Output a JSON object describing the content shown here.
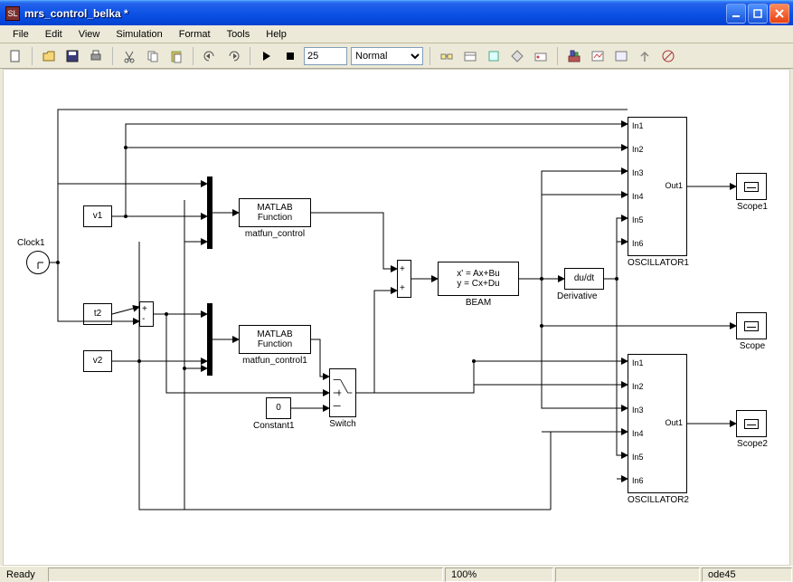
{
  "window": {
    "title": "mrs_control_belka *"
  },
  "menu": {
    "file": "File",
    "edit": "Edit",
    "view": "View",
    "simulation": "Simulation",
    "format": "Format",
    "tools": "Tools",
    "help": "Help"
  },
  "toolbar": {
    "stoptime": "25",
    "mode": "Normal",
    "icons": {
      "new": "new-icon",
      "open": "open-icon",
      "save": "save-icon",
      "print": "print-icon",
      "cut": "cut-icon",
      "copy": "copy-icon",
      "paste": "paste-icon",
      "undo": "undo-icon",
      "redo": "redo-icon",
      "play": "play-icon",
      "stop": "stop-icon"
    }
  },
  "status": {
    "ready": "Ready",
    "zoom": "100%",
    "solver": "ode45"
  },
  "blocks": {
    "clock1": "Clock1",
    "v1": "v1",
    "t2": "t2",
    "v2": "v2",
    "mfun1_line1": "MATLAB",
    "mfun1_line2": "Function",
    "mfun1_name": "matfun_control",
    "mfun2_line1": "MATLAB",
    "mfun2_line2": "Function",
    "mfun2_name": "matfun_control1",
    "const1_val": "0",
    "const1_name": "Constant1",
    "switch_name": "Switch",
    "beam_line1": "x' = Ax+Bu",
    "beam_line2": "y = Cx+Du",
    "beam_name": "BEAM",
    "deriv_text": "du/dt",
    "deriv_name": "Derivative",
    "osc1_name": "OSCILLATOR1",
    "osc2_name": "OSCILLATOR2",
    "osc_out": "Out1",
    "osc_in1": "In1",
    "osc_in2": "In2",
    "osc_in3": "In3",
    "osc_in4": "In4",
    "osc_in5": "In5",
    "osc_in6": "In6",
    "scope1": "Scope1",
    "scope": "Scope",
    "scope2": "Scope2",
    "sum_plus": "+",
    "sum_minus": "-"
  }
}
